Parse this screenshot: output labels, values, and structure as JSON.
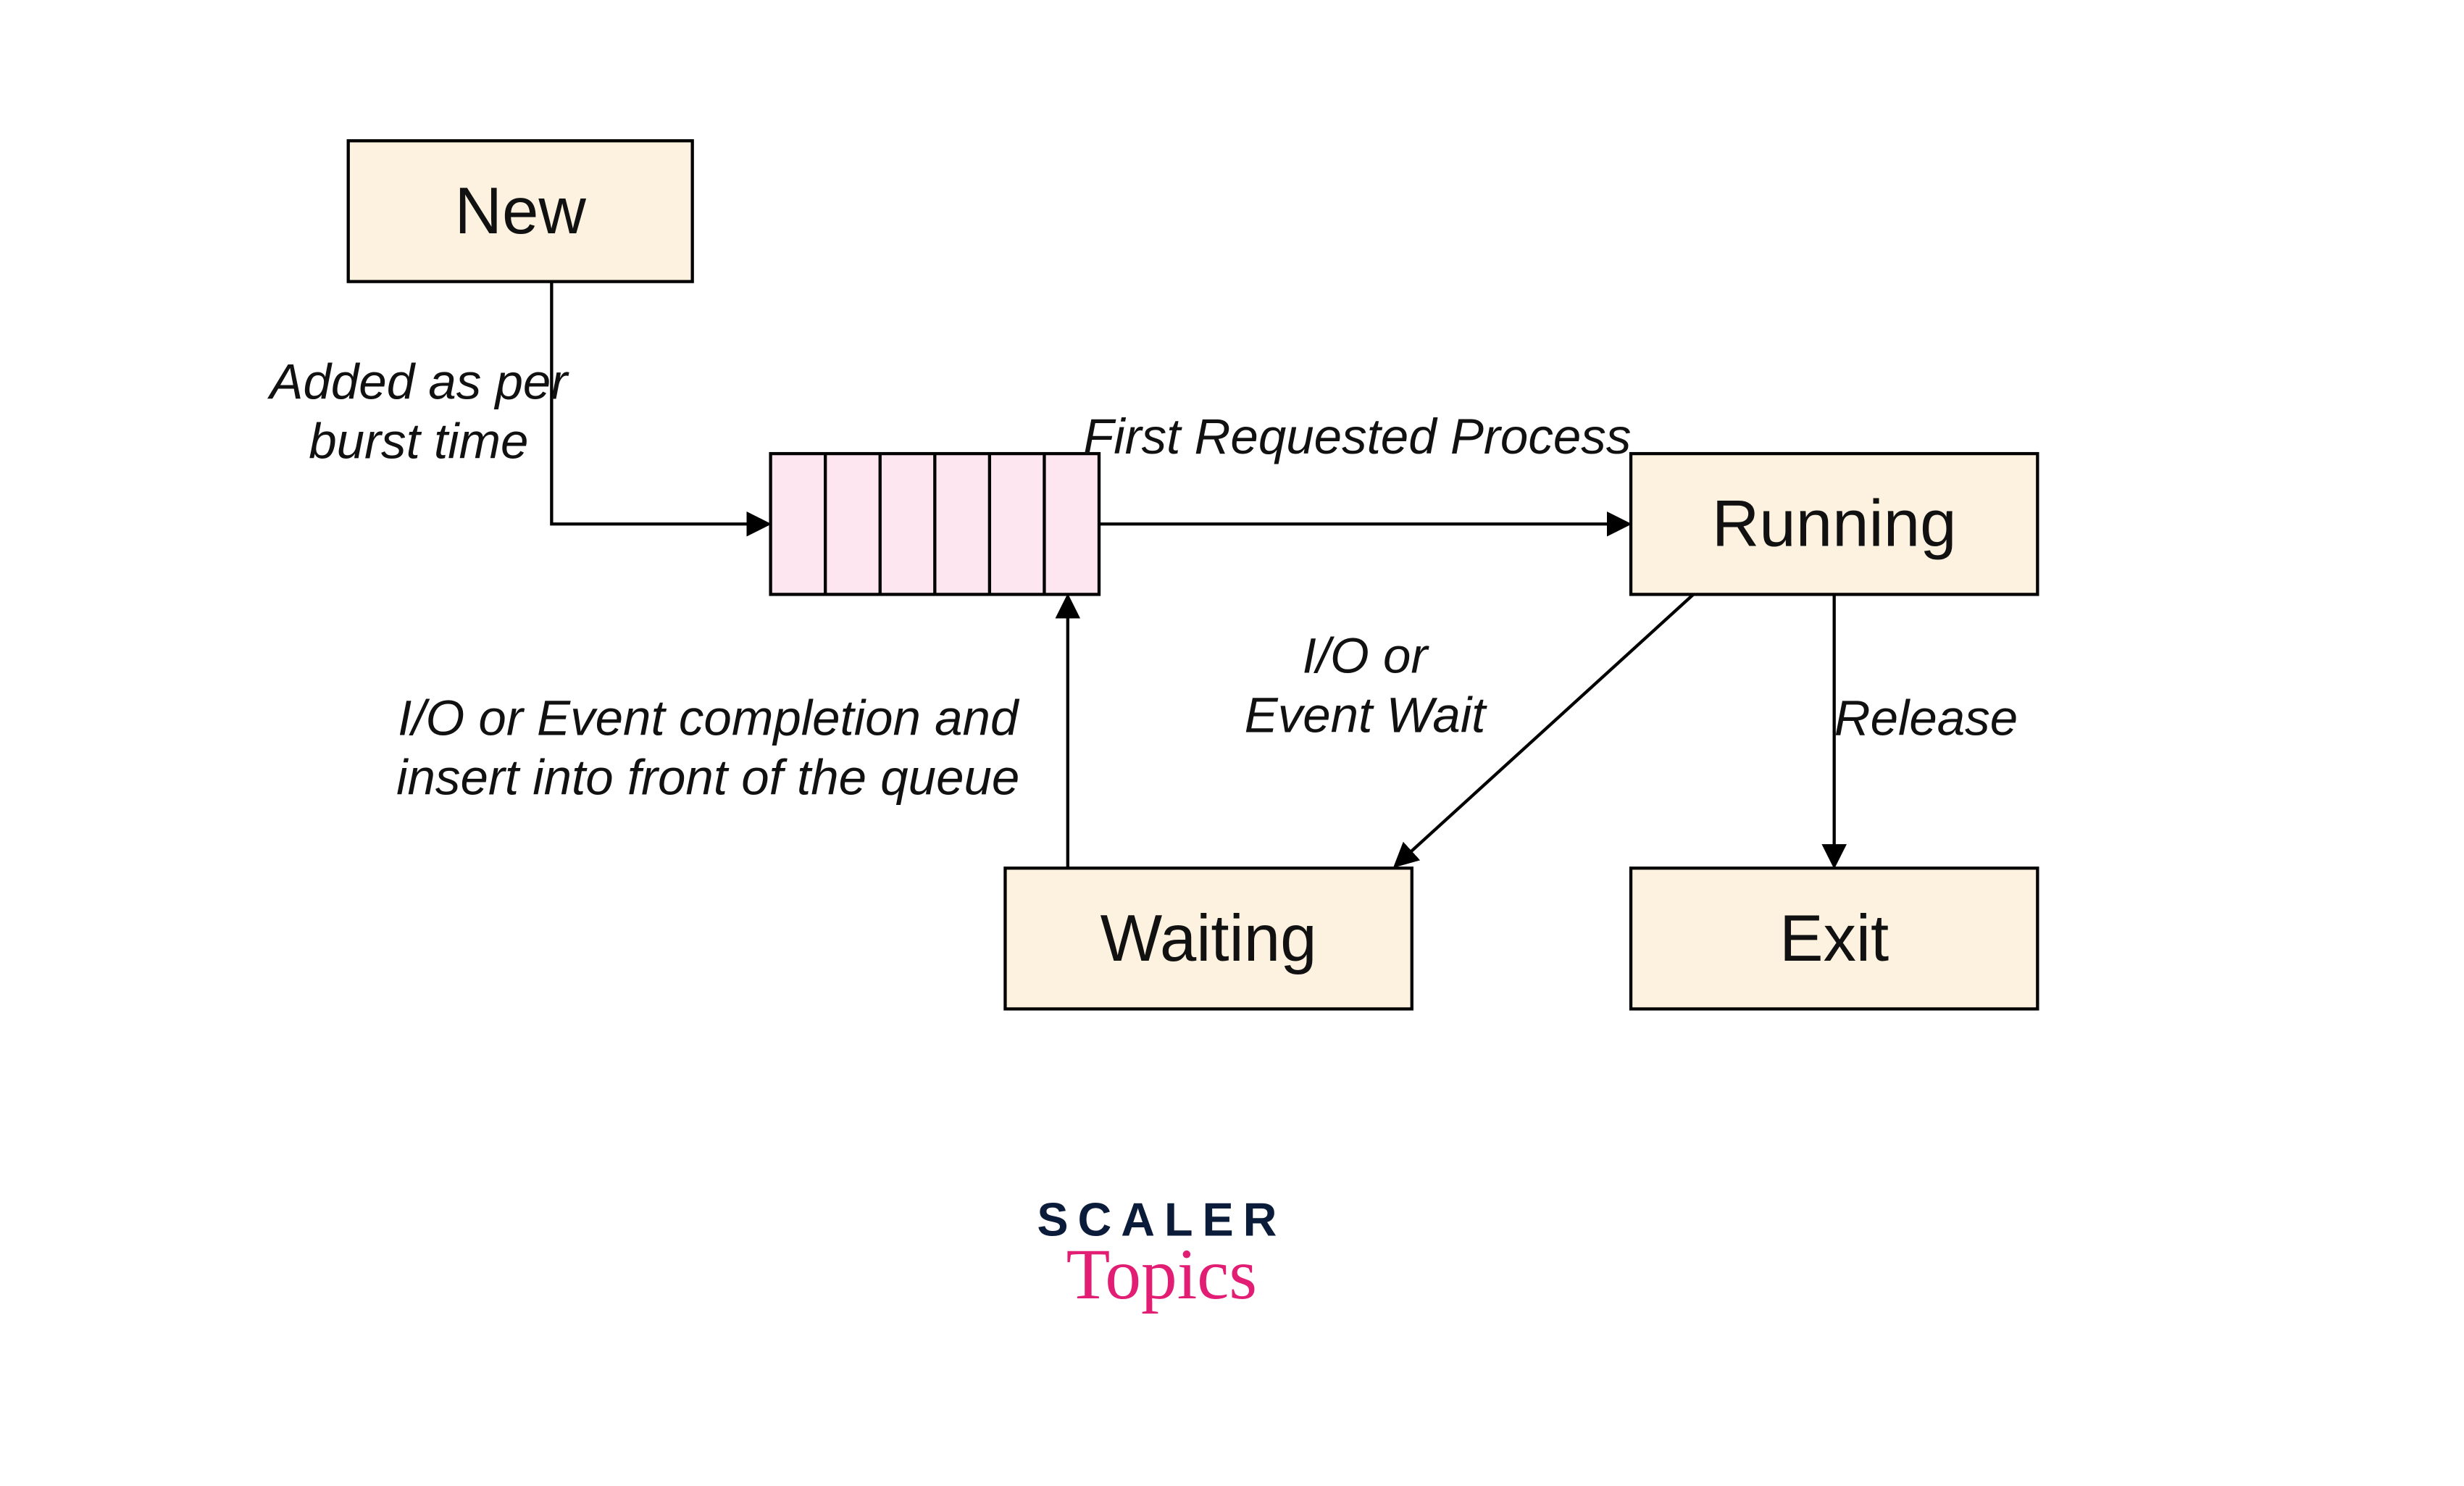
{
  "nodes": {
    "new": {
      "label": "New"
    },
    "running": {
      "label": "Running"
    },
    "waiting": {
      "label": "Waiting"
    },
    "exit": {
      "label": "Exit"
    }
  },
  "queue": {
    "slots": 6
  },
  "edges": {
    "new_to_queue": {
      "label_line1": "Added as per",
      "label_line2": "burst time"
    },
    "queue_to_running": {
      "label": "First Requested Process"
    },
    "running_to_waiting": {
      "label_line1": "I/O or",
      "label_line2": "Event Wait"
    },
    "running_to_exit": {
      "label": "Release"
    },
    "waiting_to_queue": {
      "label_line1": "I/O or Event completion and",
      "label_line2": "insert into front of the queue"
    }
  },
  "branding": {
    "line1": "SCALER",
    "line2": "Topics"
  },
  "colors": {
    "node_fill": "#fcf2df",
    "queue_fill": "#fde6f0",
    "stroke": "#000000",
    "logo_dark": "#0b1b3a",
    "logo_accent": "#e11d74"
  }
}
